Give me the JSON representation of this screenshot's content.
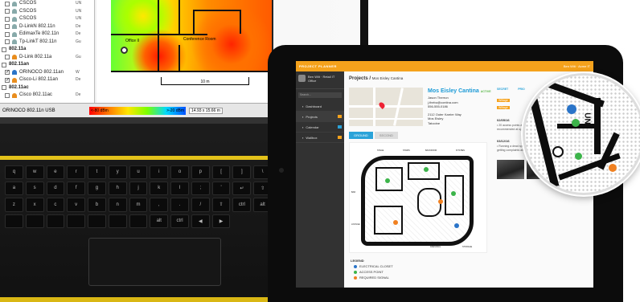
{
  "laptop": {
    "networks": [
      {
        "name": "CSCOS",
        "vendor": "UN",
        "checked": false,
        "icon": "wifi-gray"
      },
      {
        "name": "CSCOS",
        "vendor": "UN",
        "checked": false,
        "icon": "wifi-gray"
      },
      {
        "name": "CSCOS",
        "vendor": "UN",
        "checked": false,
        "icon": "wifi-gray"
      },
      {
        "name": "D-LinkN 802.11n",
        "vendor": "De",
        "checked": false,
        "icon": "wifi-gray"
      },
      {
        "name": "EdimaxTe 802.11n",
        "vendor": "De",
        "checked": false,
        "icon": "wifi-gray"
      },
      {
        "name": "Tp-LinkT 802.11n",
        "vendor": "Gu",
        "checked": false,
        "icon": "wifi-gray"
      }
    ],
    "group_a": "802.11a",
    "group_a_items": [
      {
        "name": "D-Link 802.11a",
        "vendor": "Gu",
        "checked": false,
        "icon": "wifi-orange"
      }
    ],
    "group_n": "802.11an",
    "group_n_items": [
      {
        "name": "ORINOCO 802.11an",
        "vendor": "W",
        "checked": true,
        "icon": "wifi-blue"
      },
      {
        "name": "Cisco-Li 802.11an",
        "vendor": "De",
        "checked": true,
        "icon": "wifi-orange"
      }
    ],
    "group_ac": "802.11ac",
    "group_ac_items": [
      {
        "name": "Cisco 802.11ac",
        "vendor": "De",
        "checked": false,
        "icon": "wifi-orange"
      }
    ],
    "map_labels": {
      "office": "Office II",
      "conference": "Conference Room"
    },
    "scale_label": "10 m",
    "status": {
      "adapter": "ORINOCO 802.11n USB",
      "legend_min": "<-80 dBm",
      "legend_max": ">-20 dBm",
      "dims": "14.93 x 15.66 m"
    },
    "keys": [
      "q",
      "w",
      "e",
      "r",
      "t",
      "y",
      "u",
      "i",
      "o",
      "p",
      "[",
      "]",
      "\\",
      "a",
      "s",
      "d",
      "f",
      "g",
      "h",
      "j",
      "k",
      "l",
      ";",
      "'",
      "↵",
      "⇧",
      "z",
      "x",
      "c",
      "v",
      "b",
      "n",
      "m",
      ",",
      ".",
      "/",
      "⇧",
      "ctrl",
      "alt",
      "",
      "",
      "",
      "",
      "",
      "",
      "",
      "alt",
      "ctrl",
      "◀",
      "▶"
    ]
  },
  "app": {
    "logo": "PROJECT PLANNER",
    "top_user": "Ben Wilt · Acme IT",
    "sidebar_user": "Ben Wilt · Retail IT",
    "sidebar_user_sub": "Office",
    "search_placeholder": "Search...",
    "nav": [
      {
        "label": "Dashboard",
        "badge": "",
        "active": false
      },
      {
        "label": "Projects",
        "badge": "orange",
        "active": true
      },
      {
        "label": "Calendar",
        "badge": "blue",
        "active": false
      },
      {
        "label": "Wallbox",
        "badge": "orange",
        "active": false
      }
    ],
    "breadcrumb_main": "Projects /",
    "breadcrumb_sub": "Mos Eisley Cantina",
    "venue": {
      "name": "Mos Eisley Cantina",
      "status": "ACTIVE",
      "contact": "Jason Therrun",
      "email": "j.thebu@contina.com",
      "phone": "556-555-0186",
      "address1": "2112 Outer Karrier Way",
      "address2": "Mos Eisley",
      "address3": "Tatooine"
    },
    "tabs": [
      "GROUND",
      "SECOND"
    ],
    "legend_title": "LEGEND",
    "legend": [
      {
        "label": "ELECTRICAL CLOSET",
        "color": "#2a74c8"
      },
      {
        "label": "ACCESS POINT",
        "color": "#3cb44a"
      },
      {
        "label": "REQUIRED SIGNAL",
        "color": "#f08020"
      }
    ],
    "right": {
      "head": [
        "SECRET",
        "PRIO"
      ],
      "tags": [
        "Wiltage",
        "Wiltage"
      ],
      "entries": [
        {
          "date": "02/05/16",
          "text": "• 20 access points are installed. • Ceilings are peak tile. • Required signal is recommended at upper floors."
        },
        {
          "date": "03/12/16",
          "text": "• Running a dead spot in the North Bead part of the property. • Reception is getting complaints about her speeds, may require additional AP."
        }
      ]
    },
    "floor_labels": [
      "STAGE",
      "STAIRS",
      "BACKDOOR",
      "KITCHEN",
      "BAR",
      "LOUNGE",
      "DRESSING",
      "STORAGE"
    ],
    "mag_label": "UN"
  }
}
